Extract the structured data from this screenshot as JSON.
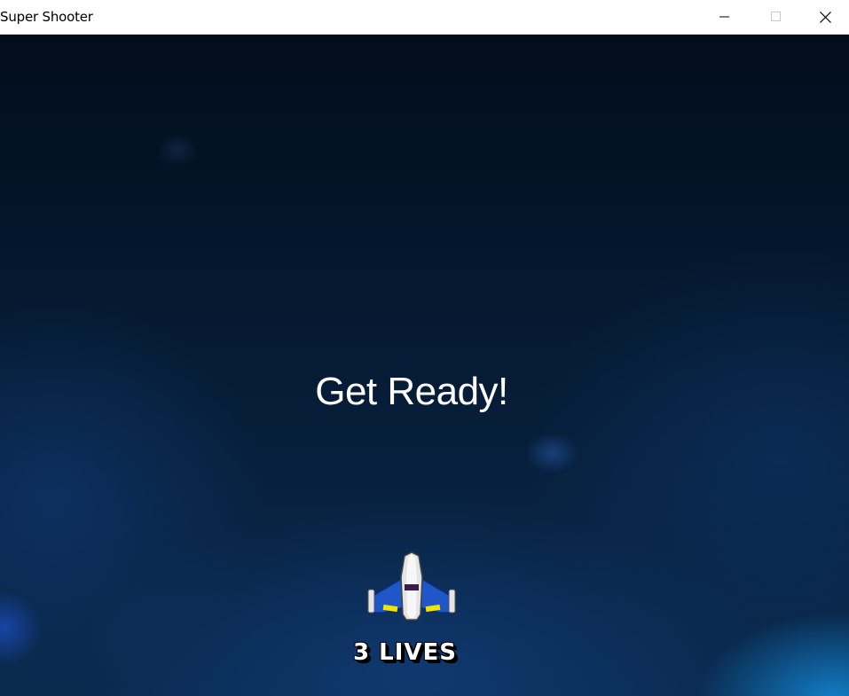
{
  "window": {
    "title": "Super Shooter",
    "controls": {
      "minimize": "minimize-icon",
      "maximize": "maximize-icon",
      "close": "close-icon"
    }
  },
  "game": {
    "message": "Get Ready!",
    "lives_label": "3 LIVES",
    "player_ship": "spaceship-icon",
    "colors": {
      "background_top": "#020d1c",
      "background_bottom": "#0a2a4e",
      "glow": "#148cdc",
      "ship_wing": "#1f57c8",
      "ship_body": "#e4e4e4",
      "ship_light": "#f2e300"
    }
  }
}
